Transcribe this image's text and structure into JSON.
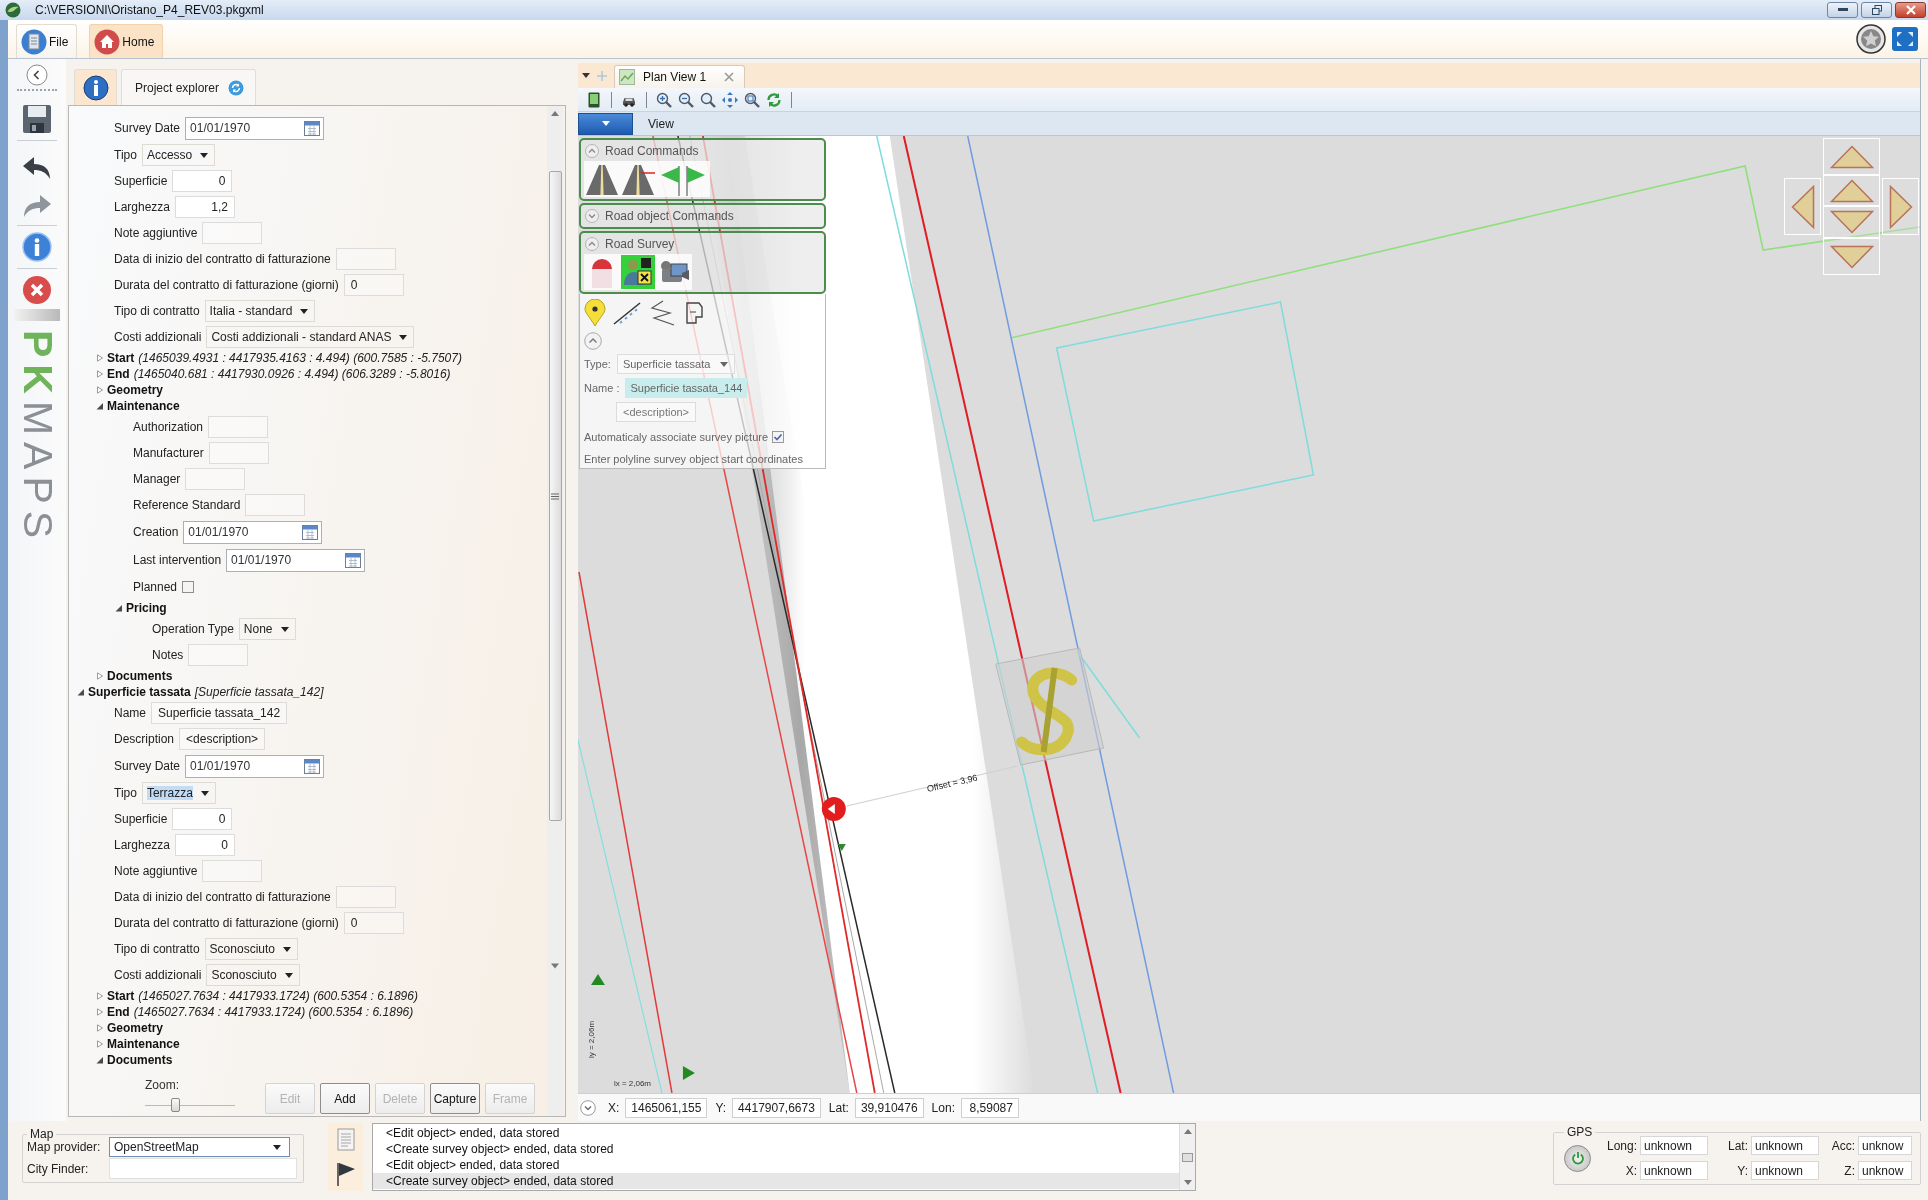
{
  "window": {
    "title": "C:\\VERSIONI\\Oristano_P4_REV03.pkgxml"
  },
  "ribbon_tabs": [
    {
      "label": "File",
      "selected": false
    },
    {
      "label": "Home",
      "selected": true
    }
  ],
  "logo": {
    "accent": "PK",
    "rest": "MAPS"
  },
  "explorer_tabs": [
    {
      "kind": "info",
      "selected": true
    },
    {
      "kind": "text",
      "label": "Project explorer",
      "selected": false
    }
  ],
  "property_tree": [
    {
      "kind": "node",
      "children": [
        {
          "kind": "date",
          "label": "Survey Date",
          "value": "01/01/1970"
        },
        {
          "kind": "dropdown",
          "label": "Tipo",
          "value": "Accesso",
          "focused": false
        },
        {
          "kind": "number",
          "label": "Superficie",
          "value": "0"
        },
        {
          "kind": "number",
          "label": "Larghezza",
          "value": "1,2"
        },
        {
          "kind": "text",
          "label": "Note aggiuntive"
        },
        {
          "kind": "text",
          "label": "Data di inizio del contratto di fatturazione"
        },
        {
          "kind": "text",
          "label": "Durata del contratto di fatturazione (giorni)",
          "value": "0"
        },
        {
          "kind": "dropdown",
          "label": "Tipo di contratto",
          "value": "Italia - standard",
          "focused": false
        },
        {
          "kind": "dropdown",
          "label": "Costi addizionali",
          "value": "Costi addizionali - standard ANAS",
          "focused": false
        },
        {
          "kind": "node",
          "label": "Start",
          "detail": "(1465039.4931 : 4417935.4163 : 4.494) (600.7585 : -5.7507)",
          "expanded": false
        },
        {
          "kind": "node",
          "label": "End",
          "detail": "(1465040.681 : 4417930.0926 : 4.494) (606.3289 : -5.8016)",
          "expanded": false
        },
        {
          "kind": "node",
          "label": "Geometry",
          "expanded": false
        },
        {
          "kind": "node",
          "label": "Maintenance",
          "expanded": true,
          "children": [
            {
              "kind": "text",
              "label": "Authorization"
            },
            {
              "kind": "text",
              "label": "Manufacturer"
            },
            {
              "kind": "text",
              "label": "Manager"
            },
            {
              "kind": "text",
              "label": "Reference Standard"
            },
            {
              "kind": "date",
              "label": "Creation",
              "value": "01/01/1970"
            },
            {
              "kind": "date",
              "label": "Last intervention",
              "value": "01/01/1970"
            },
            {
              "kind": "checkbox",
              "label": "Planned",
              "checked": false
            },
            {
              "kind": "node",
              "label": "Pricing",
              "expanded": true,
              "children": [
                {
                  "kind": "dropdown",
                  "label": "Operation Type",
                  "value": "None",
                  "focused": false
                },
                {
                  "kind": "text",
                  "label": "Notes"
                }
              ]
            }
          ]
        },
        {
          "kind": "node",
          "label": "Documents",
          "expanded": false
        }
      ]
    },
    {
      "kind": "node",
      "label": "Superficie tassata",
      "detail": "[Superficie tassata_142]",
      "expanded": true,
      "children": [
        {
          "kind": "text",
          "label": "Name",
          "value": "Superficie tassata_142"
        },
        {
          "kind": "text",
          "label": "Description",
          "value": "<description>"
        },
        {
          "kind": "date",
          "label": "Survey Date",
          "value": "01/01/1970"
        },
        {
          "kind": "dropdown",
          "label": "Tipo",
          "value": "Terrazza",
          "focused": true
        },
        {
          "kind": "number",
          "label": "Superficie",
          "value": "0"
        },
        {
          "kind": "number",
          "label": "Larghezza",
          "value": "0"
        },
        {
          "kind": "text",
          "label": "Note aggiuntive"
        },
        {
          "kind": "text",
          "label": "Data di inizio del contratto di fatturazione"
        },
        {
          "kind": "text",
          "label": "Durata del contratto di fatturazione (giorni)",
          "value": "0"
        },
        {
          "kind": "dropdown",
          "label": "Tipo di contratto",
          "value": "Sconosciuto",
          "focused": false
        },
        {
          "kind": "dropdown",
          "label": "Costi addizionali",
          "value": "Sconosciuto",
          "focused": false
        },
        {
          "kind": "node",
          "label": "Start",
          "detail": "(1465027.7634 : 4417933.1724) (600.5354 : 6.1896)",
          "expanded": false
        },
        {
          "kind": "node",
          "label": "End",
          "detail": "(1465027.7634 : 4417933.1724) (600.5354 : 6.1896)",
          "expanded": false
        },
        {
          "kind": "node",
          "label": "Geometry",
          "expanded": false
        },
        {
          "kind": "node",
          "label": "Maintenance",
          "expanded": false
        },
        {
          "kind": "node",
          "label": "Documents",
          "expanded": true,
          "children": [
            {
              "kind": "documents",
              "zoom": {
                "label": "Zoom:",
                "level": 0.32
              },
              "buttons": [
                {
                  "label": "Edit",
                  "disabled": true
                },
                {
                  "label": "Add",
                  "disabled": false
                },
                {
                  "label": "Delete",
                  "disabled": true
                },
                {
                  "label": "Capture",
                  "disabled": false
                },
                {
                  "label": "Frame",
                  "disabled": true
                }
              ]
            }
          ]
        }
      ]
    }
  ],
  "map_view": {
    "tabs": [
      {
        "label": "Plan View 1",
        "selected": true
      }
    ],
    "ribbon_tab": "View",
    "command_panels": [
      {
        "title": "Road Commands",
        "expanded": true
      },
      {
        "title": "Road object Commands",
        "expanded": false
      },
      {
        "title": "Road Survey",
        "expanded": true
      }
    ],
    "survey_form": {
      "type_label": "Type:",
      "type_value": "Superficie tassata",
      "name_label": "Name :",
      "name_value": "Superficie tassata_144",
      "description": "<description>",
      "auto_picture": {
        "label": "Automaticaly associate survey picture",
        "checked": true
      },
      "hint": "Enter polyline survey object start coordinates"
    },
    "offset_label": "Offset = 3,96",
    "scale_y_label": "ly = 2,06m",
    "scale_x_label": "lx = 2,06m",
    "coordinates": [
      {
        "label": "X:",
        "value": "1465061,155"
      },
      {
        "label": "Y:",
        "value": "4417907,6673"
      },
      {
        "label": "Lat:",
        "value": "39,910476"
      },
      {
        "label": "Lon:",
        "value": "8,59087"
      }
    ]
  },
  "map_settings": {
    "title": "Map",
    "provider_label": "Map provider:",
    "provider": "OpenStreetMap",
    "city_label": "City Finder:"
  },
  "log": [
    {
      "text": "<Edit object> ended, data stored",
      "selected": false
    },
    {
      "text": "<Create survey object> ended, data stored",
      "selected": false
    },
    {
      "text": "<Edit object> ended, data stored",
      "selected": false
    },
    {
      "text": "<Create survey object> ended, data stored",
      "selected": true
    }
  ],
  "gps": {
    "title": "GPS",
    "fields": [
      {
        "label": "Long:",
        "value": "unknown"
      },
      {
        "label": "Lat:",
        "value": "unknown"
      },
      {
        "label": "Acc:",
        "value": "unknow"
      },
      {
        "label": "X:",
        "value": "unknown"
      },
      {
        "label": "Y:",
        "value": "unknown"
      },
      {
        "label": "Z:",
        "value": "unknow"
      }
    ]
  }
}
